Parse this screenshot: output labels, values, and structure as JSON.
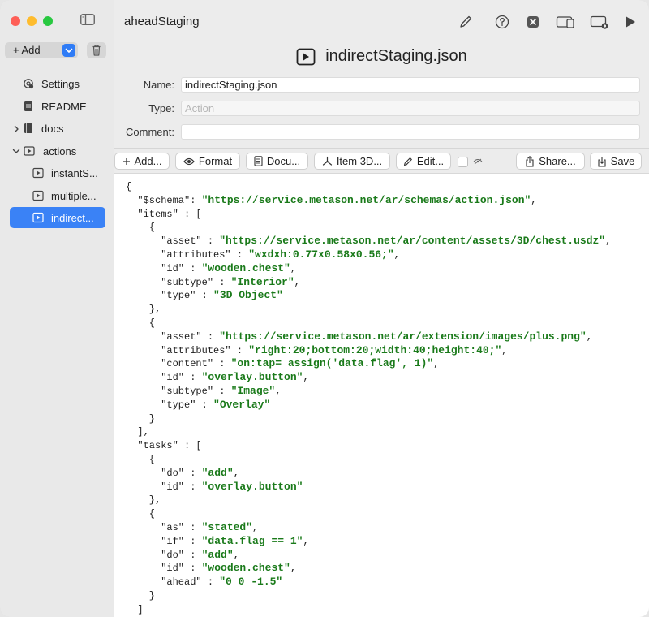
{
  "window": {
    "title": "aheadStaging"
  },
  "sidebar": {
    "add_label": "+ Add",
    "items": [
      {
        "label": "Settings",
        "icon": "gear-icon"
      },
      {
        "label": "README",
        "icon": "document-icon"
      },
      {
        "label": "docs",
        "icon": "book-icon"
      },
      {
        "label": "actions",
        "icon": "folder-play-icon"
      },
      {
        "label": "instantS...",
        "icon": "play-file-icon"
      },
      {
        "label": "multiple...",
        "icon": "play-file-icon"
      },
      {
        "label": "indirect...",
        "icon": "play-file-icon"
      }
    ],
    "selected_index": 6,
    "accent": "#3a82f6"
  },
  "document": {
    "title": "indirectStaging.json",
    "name_label": "Name:",
    "name_value": "indirectStaging.json",
    "type_label": "Type:",
    "type_placeholder": "Action",
    "comment_label": "Comment:",
    "comment_value": ""
  },
  "toolbar": {
    "add": "Add...",
    "format": "Format",
    "docu": "Docu...",
    "item3d": "Item 3D...",
    "edit": "Edit...",
    "share": "Share...",
    "save": "Save"
  },
  "code": [
    {
      "t": "{"
    },
    {
      "k": "  \"$schema\": ",
      "v": "\"https://service.metason.net/ar/schemas/action.json\"",
      "e": ","
    },
    {
      "k": "  \"items\" : ["
    },
    {
      "k": "    {"
    },
    {
      "k": "      \"asset\" : ",
      "v": "\"https://service.metason.net/ar/content/assets/3D/chest.usdz\"",
      "e": ","
    },
    {
      "k": "      \"attributes\" : ",
      "v": "\"wxdxh:0.77x0.58x0.56;\"",
      "e": ","
    },
    {
      "k": "      \"id\" : ",
      "v": "\"wooden.chest\"",
      "e": ","
    },
    {
      "k": "      \"subtype\" : ",
      "v": "\"Interior\"",
      "e": ","
    },
    {
      "k": "      \"type\" : ",
      "v": "\"3D Object\"",
      "e": ""
    },
    {
      "k": "    },"
    },
    {
      "k": "    {"
    },
    {
      "k": "      \"asset\" : ",
      "v": "\"https://service.metason.net/ar/extension/images/plus.png\"",
      "e": ","
    },
    {
      "k": "      \"attributes\" : ",
      "v": "\"right:20;bottom:20;width:40;height:40;\"",
      "e": ","
    },
    {
      "k": "      \"content\" : ",
      "v": "\"on:tap= assign('data.flag', 1)\"",
      "e": ","
    },
    {
      "k": "      \"id\" : ",
      "v": "\"overlay.button\"",
      "e": ","
    },
    {
      "k": "      \"subtype\" : ",
      "v": "\"Image\"",
      "e": ","
    },
    {
      "k": "      \"type\" : ",
      "v": "\"Overlay\"",
      "e": ""
    },
    {
      "k": "    }"
    },
    {
      "k": "  ],"
    },
    {
      "k": "  \"tasks\" : ["
    },
    {
      "k": "    {"
    },
    {
      "k": "      \"do\" : ",
      "v": "\"add\"",
      "e": ","
    },
    {
      "k": "      \"id\" : ",
      "v": "\"overlay.button\"",
      "e": ""
    },
    {
      "k": "    },"
    },
    {
      "k": "    {"
    },
    {
      "k": "      \"as\" : ",
      "v": "\"stated\"",
      "e": ","
    },
    {
      "k": "      \"if\" : ",
      "v": "\"data.flag == 1\"",
      "e": ","
    },
    {
      "k": "      \"do\" : ",
      "v": "\"add\"",
      "e": ","
    },
    {
      "k": "      \"id\" : ",
      "v": "\"wooden.chest\"",
      "e": ","
    },
    {
      "k": "      \"ahead\" : ",
      "v": "\"0 0 -1.5\"",
      "e": ""
    },
    {
      "k": "    }"
    },
    {
      "k": "  ]"
    },
    {
      "t": "}"
    }
  ]
}
